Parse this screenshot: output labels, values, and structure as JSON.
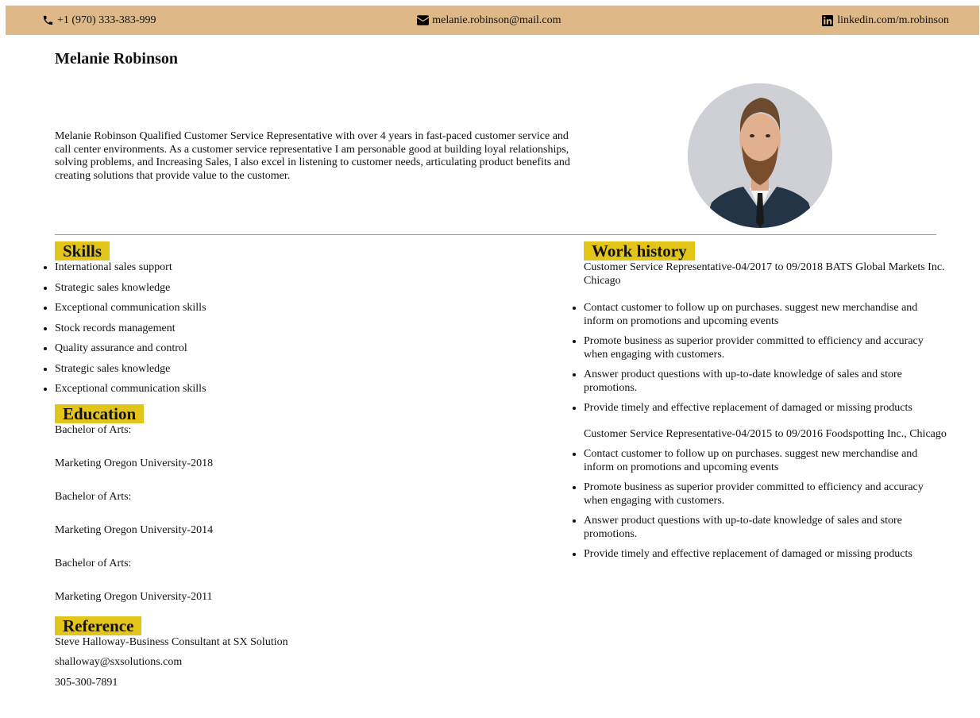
{
  "header": {
    "phone": "+1 (970) 333-383-999",
    "email": "melanie.robinson@mail.com",
    "linkedin": "linkedin.com/m.robinson",
    "phone_icon": "phone-icon",
    "email_icon": "envelope-icon",
    "linkedin_icon": "linkedin-icon",
    "bar_color": "#deb887"
  },
  "profile": {
    "name": "Melanie Robinson",
    "summary": "Melanie Robinson Qualified Customer Service Representative with over 4 years in fast-paced customer service and call center environments. As a customer service representative I am personable good at building loyal relationships, solving problems, and Increasing Sales, I also excel in listening to customer needs, articulating product benefits and creating solutions that provide value to the customer."
  },
  "skills": {
    "heading": "Skills",
    "items": [
      "International sales support",
      "Strategic sales knowledge",
      "Exceptional communication skills",
      "Stock records management",
      "Quality assurance and control",
      "Strategic sales knowledge",
      "Exceptional communication skills"
    ]
  },
  "education": {
    "heading": "Education",
    "lines": [
      "Bachelor of Arts:",
      "Marketing Oregon University-2018",
      "Bachelor of Arts:",
      "Marketing Oregon University-2014",
      "Bachelor of Arts:",
      "Marketing Oregon University-2011"
    ]
  },
  "reference": {
    "heading": "Reference",
    "lines": [
      "Steve Halloway-Business Consultant at SX Solution",
      "shalloway@sxsolutions.com",
      "305-300-7891"
    ]
  },
  "work": {
    "heading": "Work history",
    "jobs": [
      {
        "title": "Customer Service Representative-04/2017 to 09/2018 BATS Global Markets Inc. Chicago",
        "bullets": [
          "Contact customer to follow up on purchases. suggest new merchandise and inform on promotions and upcoming events",
          "Promote business as superior provider committed to efficiency and accuracy when engaging with customers.",
          "Answer product questions with up-to-date knowledge of sales and store promotions.",
          "Provide timely and effective replacement of damaged or missing products"
        ]
      },
      {
        "title": "Customer Service Representative-04/2015 to 09/2016 Foodspotting Inc., Chicago",
        "bullets": [
          "Contact customer to follow up on purchases. suggest new merchandise and inform on promotions and upcoming events",
          "Promote business as superior provider committed to efficiency and accuracy when engaging with customers.",
          "Answer product questions with up-to-date knowledge of sales and store promotions.",
          "Provide timely and effective replacement of damaged or missing products"
        ]
      }
    ]
  },
  "colors": {
    "heading_highlight": "#e3c51a"
  }
}
